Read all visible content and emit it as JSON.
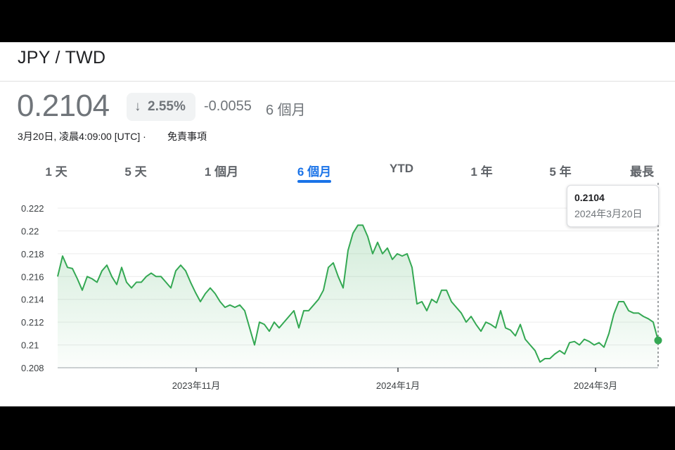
{
  "header": {
    "pair": "JPY / TWD",
    "price": "0.2104",
    "badge_arrow": "↓",
    "change_pct": "2.55%",
    "change_abs": "-0.0055",
    "period": "6 個月",
    "timestamp": "3月20日, 凌晨4:09:00 [UTC] ·",
    "disclaimer": "免責事項"
  },
  "tabs": [
    {
      "label": "1 天"
    },
    {
      "label": "5 天"
    },
    {
      "label": "1 個月"
    },
    {
      "label": "6 個月",
      "active": true
    },
    {
      "label": "YTD"
    },
    {
      "label": "1 年"
    },
    {
      "label": "5 年"
    },
    {
      "label": "最長"
    }
  ],
  "tooltip": {
    "value": "0.2104",
    "date": "2024年3月20日"
  },
  "colors": {
    "line": "#34a853",
    "active_tab": "#1a73e8",
    "text_muted": "#70757a"
  },
  "chart_data": {
    "type": "area",
    "x_axis_ticks": [
      "2023年11月",
      "2024年1月",
      "2024年3月"
    ],
    "y_ticks": [
      "0.222",
      "0.22",
      "0.218",
      "0.216",
      "0.214",
      "0.212",
      "0.21",
      "0.208"
    ],
    "ylim": [
      0.208,
      0.222
    ],
    "grid": true,
    "values": [
      0.216,
      0.2178,
      0.2168,
      0.2167,
      0.2158,
      0.2148,
      0.216,
      0.2158,
      0.2155,
      0.2165,
      0.217,
      0.216,
      0.2153,
      0.2168,
      0.2155,
      0.215,
      0.2155,
      0.2155,
      0.216,
      0.2163,
      0.216,
      0.216,
      0.2155,
      0.215,
      0.2165,
      0.217,
      0.2165,
      0.2155,
      0.2146,
      0.2138,
      0.2145,
      0.215,
      0.2145,
      0.2138,
      0.2133,
      0.2135,
      0.2133,
      0.2135,
      0.213,
      0.2115,
      0.21,
      0.212,
      0.2118,
      0.2112,
      0.212,
      0.2115,
      0.212,
      0.2125,
      0.213,
      0.2115,
      0.213,
      0.213,
      0.2135,
      0.214,
      0.2148,
      0.2168,
      0.2172,
      0.216,
      0.215,
      0.2183,
      0.2198,
      0.2205,
      0.2205,
      0.2195,
      0.218,
      0.219,
      0.218,
      0.2185,
      0.2175,
      0.218,
      0.2178,
      0.218,
      0.2168,
      0.2136,
      0.2138,
      0.213,
      0.214,
      0.2137,
      0.2148,
      0.2148,
      0.2138,
      0.2133,
      0.2128,
      0.212,
      0.2125,
      0.2118,
      0.2112,
      0.212,
      0.2118,
      0.2115,
      0.213,
      0.2115,
      0.2113,
      0.2108,
      0.2118,
      0.2105,
      0.21,
      0.2095,
      0.2085,
      0.2088,
      0.2088,
      0.2092,
      0.2095,
      0.2092,
      0.2102,
      0.2103,
      0.21,
      0.2105,
      0.2103,
      0.21,
      0.2102,
      0.2098,
      0.211,
      0.2127,
      0.2138,
      0.2138,
      0.213,
      0.2128,
      0.2128,
      0.2125,
      0.2123,
      0.212,
      0.2104
    ]
  }
}
